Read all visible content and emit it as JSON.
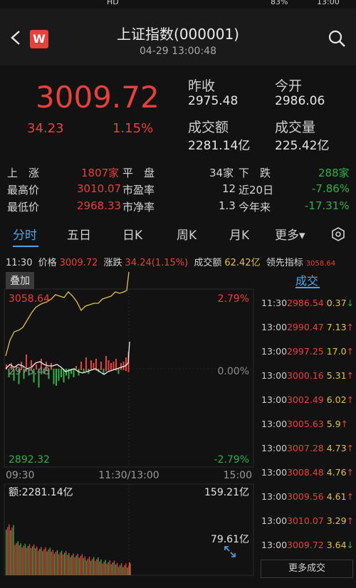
{
  "status_bar": {
    "left": "HD",
    "battery": "83%",
    "time": "13:00"
  },
  "header": {
    "logo_letter": "W",
    "title": "上证指数(000001)",
    "timestamp": "04-29 13:00:48"
  },
  "quote": {
    "price": "3009.72",
    "change": "34.23",
    "change_pct": "1.15%",
    "prev_close_label": "昨收",
    "prev_close": "2975.48",
    "open_label": "今开",
    "open": "2986.06",
    "turnover_label": "成交额",
    "turnover": "2281.14亿",
    "volume_label": "成交量",
    "volume": "225.42亿"
  },
  "stats": [
    {
      "label": "上　涨",
      "value": "1807家",
      "label2": "平　盘",
      "value2": "34家",
      "label3": "下　跌",
      "value3": "288家"
    },
    {
      "label": "最高价",
      "value": "3010.07",
      "label2": "市盈率",
      "value2": "12",
      "label3": "近20日",
      "value3": "-7.86%"
    },
    {
      "label": "最低价",
      "value": "2968.33",
      "label2": "市净率",
      "value2": "1.3",
      "label3": "今年来",
      "value3": "-17.31%"
    }
  ],
  "tabs": [
    "分时",
    "五日",
    "日K",
    "周K",
    "月K",
    "更多▾"
  ],
  "infoline": {
    "time": "11:30",
    "price_label": "价格",
    "price": "3009.72",
    "change_label": "涨跌",
    "change": "34.24(1.15%)",
    "turnover_label": "成交额",
    "turnover": "62.42亿",
    "lead_label": "领先指标",
    "lead": "3058.64"
  },
  "chart": {
    "overlay_label": "叠加",
    "y_top": "3058.64",
    "y_mid": "2975.48",
    "y_bottom": "2892.32",
    "pct_top": "2.79%",
    "pct_mid": "0.00%",
    "pct_bottom": "-2.79%",
    "x_start": "09:30",
    "x_mid": "11:30/13:00",
    "x_end": "15:00",
    "vol_label": "额:2281.14亿",
    "vol_max": "159.21亿",
    "vol_mid": "79.61亿"
  },
  "chart_data": {
    "type": "line",
    "title": "",
    "ylim": [
      2892.32,
      3058.64
    ],
    "x": [
      "09:30",
      "11:30/13:00",
      "15:00"
    ],
    "series": []
  },
  "trades": {
    "tab_label": "成交",
    "rows": [
      {
        "time": "11:30",
        "price": "2986.54",
        "vol": "0.37",
        "dir": "↓",
        "color": "green"
      },
      {
        "time": "13:00",
        "price": "2990.47",
        "vol": "7.13",
        "dir": "↑",
        "color": "red"
      },
      {
        "time": "13:00",
        "price": "2997.25",
        "vol": "17.0",
        "dir": "↑",
        "color": "red"
      },
      {
        "time": "13:00",
        "price": "3000.16",
        "vol": "5.31",
        "dir": "↑",
        "color": "red"
      },
      {
        "time": "13:00",
        "price": "3002.49",
        "vol": "6.02",
        "dir": "↑",
        "color": "red"
      },
      {
        "time": "13:00",
        "price": "3005.63",
        "vol": "5.9",
        "dir": "↑",
        "color": "red"
      },
      {
        "time": "13:00",
        "price": "3007.28",
        "vol": "4.73",
        "dir": "↑",
        "color": "red"
      },
      {
        "time": "13:00",
        "price": "3008.48",
        "vol": "4.76",
        "dir": "↑",
        "color": "red"
      },
      {
        "time": "13:00",
        "price": "3009.56",
        "vol": "4.61",
        "dir": "↑",
        "color": "red"
      },
      {
        "time": "13:00",
        "price": "3010.07",
        "vol": "3.29",
        "dir": "↑",
        "color": "red"
      },
      {
        "time": "13:00",
        "price": "3009.72",
        "vol": "3.64",
        "dir": "↓",
        "color": "green"
      }
    ],
    "more_label": "更多成交"
  },
  "colors": {
    "up": "#e8413b",
    "down": "#2fb14a",
    "accent": "#4aa6e8",
    "avg_line": "#e0c24a"
  }
}
